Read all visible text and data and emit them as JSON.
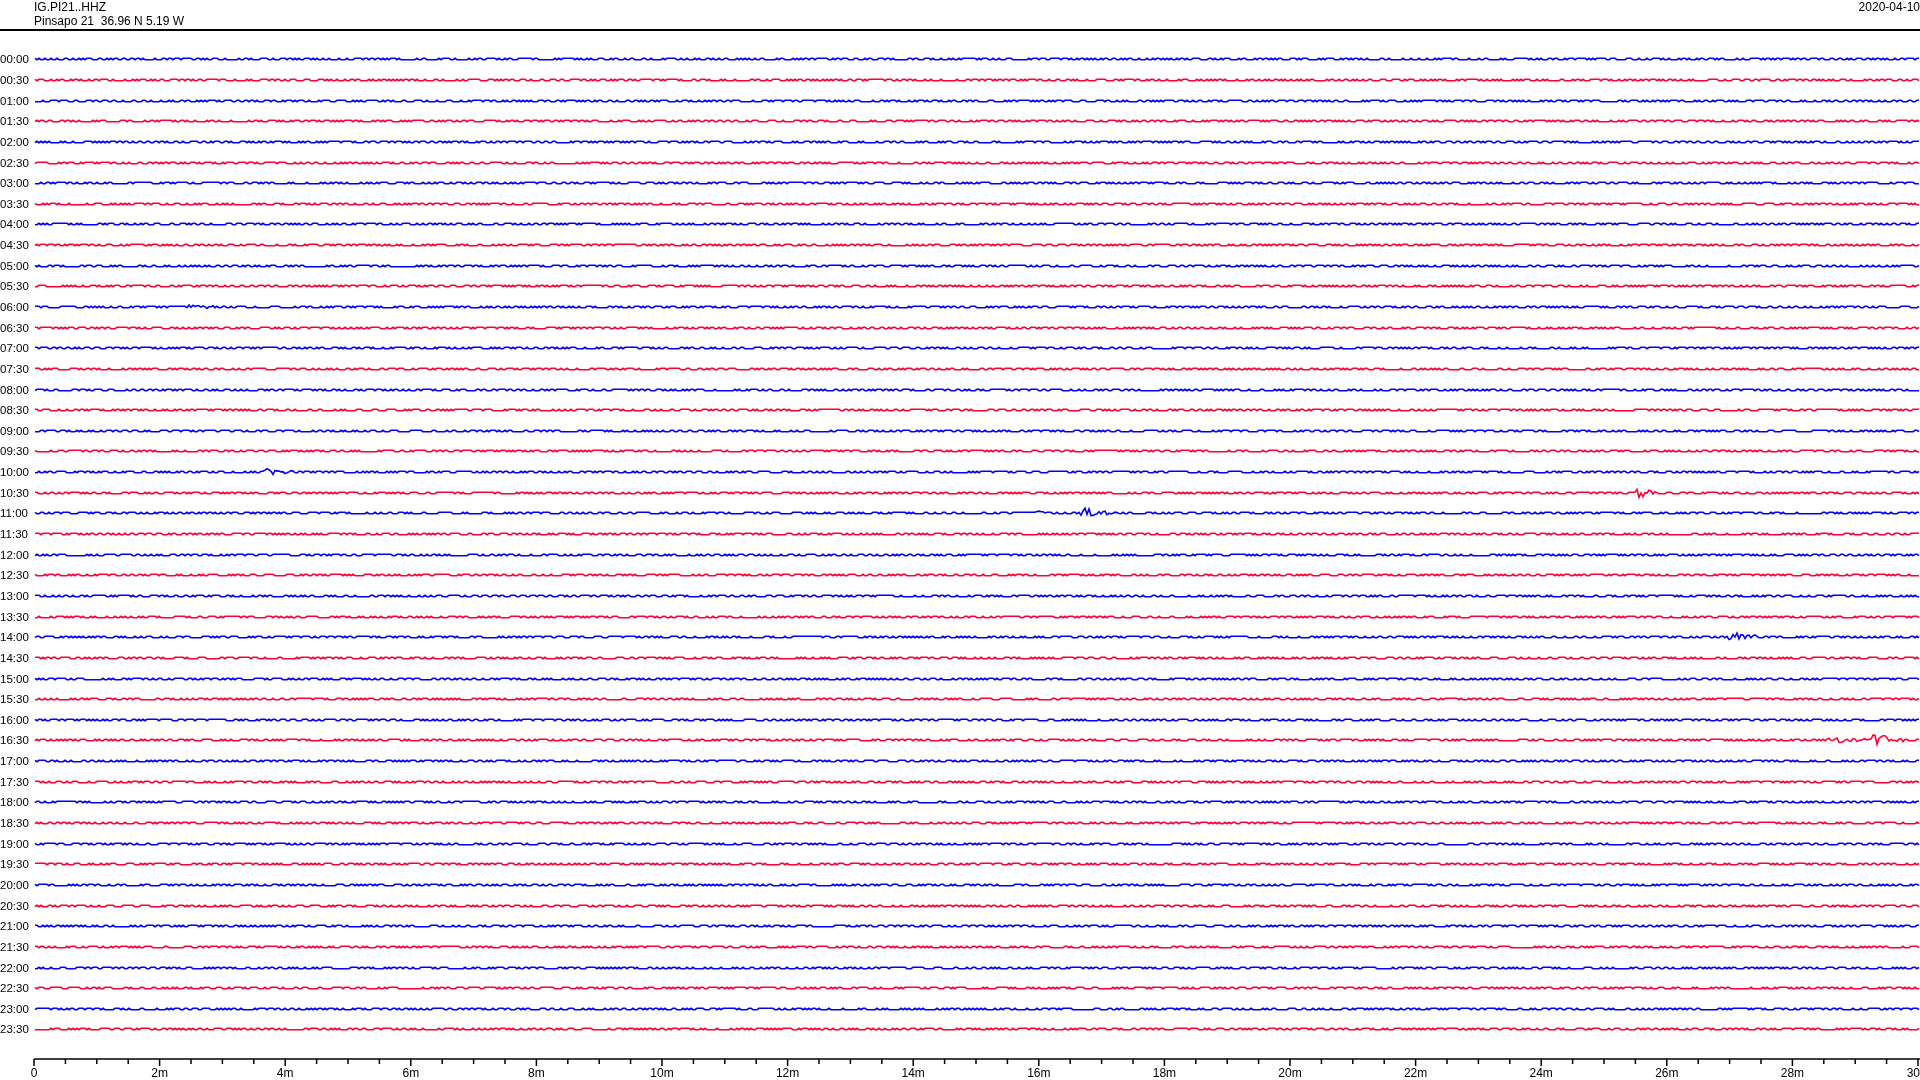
{
  "header": {
    "station": "IG.PI21..HHZ",
    "location": "Pinsapo 21  36.96 N 5.19 W",
    "date": "2020-04-10"
  },
  "traces": [
    {
      "time": "00:00",
      "color": "#0000ff"
    },
    {
      "time": "00:30",
      "color": "#ff0033"
    },
    {
      "time": "01:00",
      "color": "#0000ff"
    },
    {
      "time": "01:30",
      "color": "#ff0033"
    },
    {
      "time": "02:00",
      "color": "#0000ff"
    },
    {
      "time": "02:30",
      "color": "#ff0033"
    },
    {
      "time": "03:00",
      "color": "#0000ff"
    },
    {
      "time": "03:30",
      "color": "#ff0033"
    },
    {
      "time": "04:00",
      "color": "#0000ff"
    },
    {
      "time": "04:30",
      "color": "#ff0033"
    },
    {
      "time": "05:00",
      "color": "#0000ff"
    },
    {
      "time": "05:30",
      "color": "#ff0033"
    },
    {
      "time": "06:00",
      "color": "#0000ff"
    },
    {
      "time": "06:30",
      "color": "#ff0033"
    },
    {
      "time": "07:00",
      "color": "#0000ff"
    },
    {
      "time": "07:30",
      "color": "#ff0033"
    },
    {
      "time": "08:00",
      "color": "#0000ff"
    },
    {
      "time": "08:30",
      "color": "#ff0033"
    },
    {
      "time": "09:00",
      "color": "#0000ff"
    },
    {
      "time": "09:30",
      "color": "#ff0033"
    },
    {
      "time": "10:00",
      "color": "#0000ff"
    },
    {
      "time": "10:30",
      "color": "#ff0033"
    },
    {
      "time": "11:00",
      "color": "#0000ff"
    },
    {
      "time": "11:30",
      "color": "#ff0033"
    },
    {
      "time": "12:00",
      "color": "#0000ff"
    },
    {
      "time": "12:30",
      "color": "#ff0033"
    },
    {
      "time": "13:00",
      "color": "#0000ff"
    },
    {
      "time": "13:30",
      "color": "#ff0033"
    },
    {
      "time": "14:00",
      "color": "#0000ff"
    },
    {
      "time": "14:30",
      "color": "#ff0033"
    },
    {
      "time": "15:00",
      "color": "#0000ff"
    },
    {
      "time": "15:30",
      "color": "#ff0033"
    },
    {
      "time": "16:00",
      "color": "#0000ff"
    },
    {
      "time": "16:30",
      "color": "#ff0033"
    },
    {
      "time": "17:00",
      "color": "#0000ff"
    },
    {
      "time": "17:30",
      "color": "#ff0033"
    },
    {
      "time": "18:00",
      "color": "#0000ff"
    },
    {
      "time": "18:30",
      "color": "#ff0033"
    },
    {
      "time": "19:00",
      "color": "#0000ff"
    },
    {
      "time": "19:30",
      "color": "#ff0033"
    },
    {
      "time": "20:00",
      "color": "#0000ff"
    },
    {
      "time": "20:30",
      "color": "#ff0033"
    },
    {
      "time": "21:00",
      "color": "#0000ff"
    },
    {
      "time": "21:30",
      "color": "#ff0033"
    },
    {
      "time": "22:00",
      "color": "#0000ff"
    },
    {
      "time": "22:30",
      "color": "#ff0033"
    },
    {
      "time": "23:00",
      "color": "#0000ff"
    },
    {
      "time": "23:30",
      "color": "#ff0033"
    }
  ],
  "x_axis": {
    "labels": [
      "0",
      "2m",
      "4m",
      "6m",
      "8m",
      "10m",
      "12m",
      "14m",
      "16m",
      "18m",
      "20m",
      "22m",
      "24m",
      "26m",
      "28m",
      "30"
    ]
  }
}
